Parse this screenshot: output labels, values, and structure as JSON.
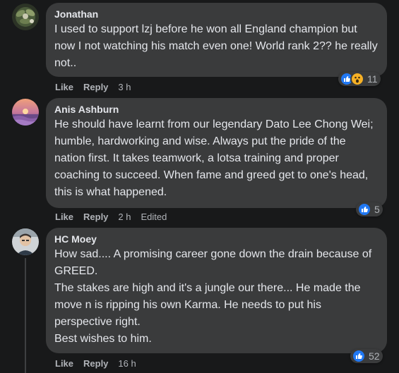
{
  "comments": [
    {
      "author": "Jonathan",
      "text": [
        "I used to support lzj before he won all England champion but now I not watching his match even one! World rank 2?? he really not.."
      ],
      "like_label": "Like",
      "reply_label": "Reply",
      "time": "3 h",
      "edited": "",
      "reaction_count": "11",
      "reactions": [
        "like-icon",
        "wow-icon"
      ]
    },
    {
      "author": "Anis Ashburn",
      "text": [
        "He should have learnt from our legendary Dato Lee Chong Wei; humble, hardworking and wise. Always put the pride of the nation first. It takes teamwork, a lotsa training and proper coaching to succeed. When fame and greed get to one's head, this is what happened."
      ],
      "like_label": "Like",
      "reply_label": "Reply",
      "time": "2 h",
      "edited": "Edited",
      "reaction_count": "5",
      "reactions": [
        "like-icon"
      ]
    },
    {
      "author": "HC Moey",
      "text": [
        "How sad.... A promising career gone down the drain because of GREED.",
        "The stakes are high and it's a jungle our there... He made the move n is ripping his own Karma. He needs to put his perspective right.",
        "Best wishes to him."
      ],
      "like_label": "Like",
      "reply_label": "Reply",
      "time": "16 h",
      "edited": "",
      "reaction_count": "52",
      "reactions": [
        "like-icon"
      ]
    }
  ],
  "colors": {
    "background": "#18191a",
    "bubble": "#3a3b3c",
    "text": "#e4e6eb",
    "secondary_text": "#b0b3b8",
    "like_blue": "#2078f4",
    "wow_yellow": "#f7b125"
  }
}
